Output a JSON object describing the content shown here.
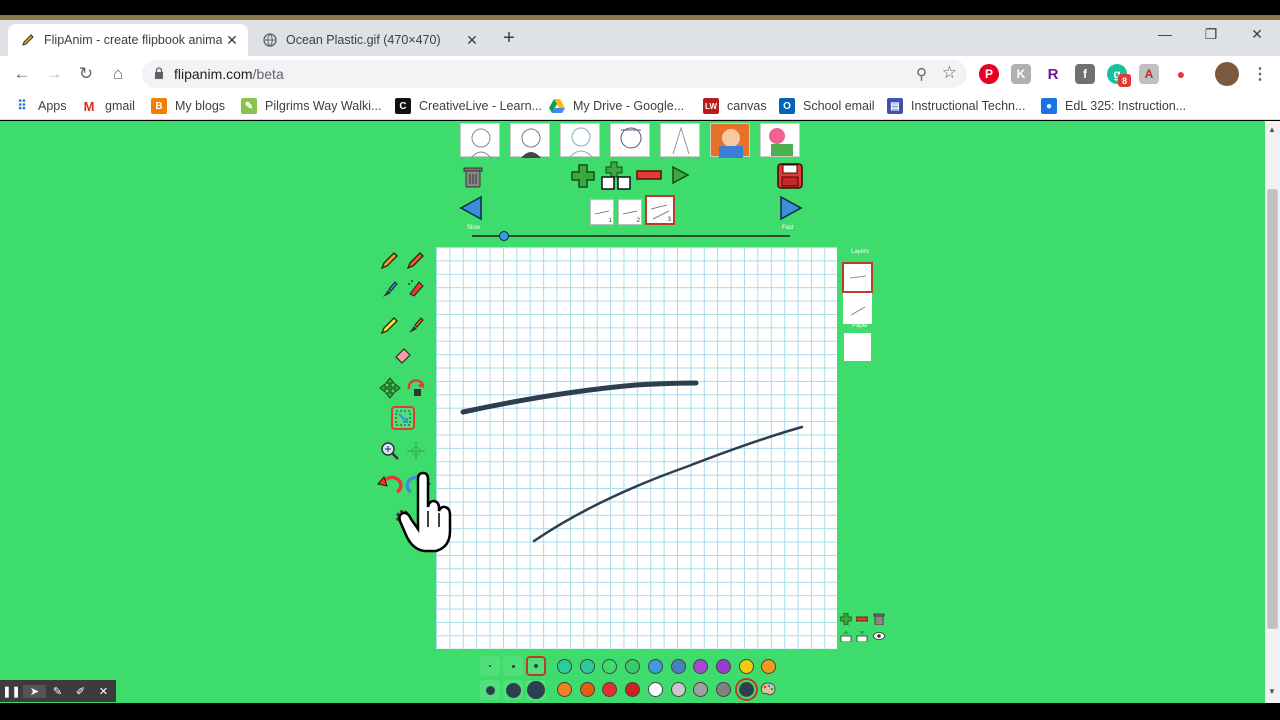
{
  "browser": {
    "tabs": [
      {
        "title": "FlipAnim - create flipbook anima",
        "active": true
      },
      {
        "title": "Ocean Plastic.gif (470×470)",
        "active": false
      }
    ],
    "url_host": "flipanim.com",
    "url_path": "/beta",
    "bookmarks": [
      {
        "label": "Apps",
        "icon": "apps-grid-icon"
      },
      {
        "label": "gmail",
        "icon": "gmail-icon"
      },
      {
        "label": "My blogs",
        "icon": "blogger-icon"
      },
      {
        "label": "Pilgrims Way Walki...",
        "icon": "leaf-icon"
      },
      {
        "label": "CreativeLive - Learn...",
        "icon": "creativelive-icon"
      },
      {
        "label": "My Drive - Google...",
        "icon": "google-drive-icon"
      },
      {
        "label": "canvas",
        "icon": "canvas-icon"
      },
      {
        "label": "School email",
        "icon": "outlook-icon"
      },
      {
        "label": "Instructional Techn...",
        "icon": "calendar-icon"
      },
      {
        "label": "EdL 325: Instruction...",
        "icon": "person-icon"
      }
    ],
    "extension_badge": "8"
  },
  "app": {
    "labels": {
      "slow": "Slow",
      "fast": "Fast",
      "layers": "Layers",
      "paper": "Paper"
    },
    "frames": [
      "1",
      "2",
      "3"
    ],
    "selected_frame": "3",
    "speed_fraction": 0.1,
    "palette_row1": [
      "#2ecc9a",
      "#2ecc9a",
      "#3ddc6c",
      "#33cc66",
      "#3b9be0",
      "#4a7fc0",
      "#a44ad0",
      "#9b3bd0",
      "#f0cc10",
      "#f09a20"
    ],
    "palette_row2": [
      "#f08020",
      "#e06010",
      "#e03030",
      "#d02020",
      "#ffffff",
      "#c8c8c8",
      "#a0a0a0",
      "#808080",
      "#2c3e50"
    ]
  },
  "colors": {
    "page_bg": "#3ddc6c",
    "stroke": "#2c3e50",
    "selected_outline": "#c0392b"
  }
}
